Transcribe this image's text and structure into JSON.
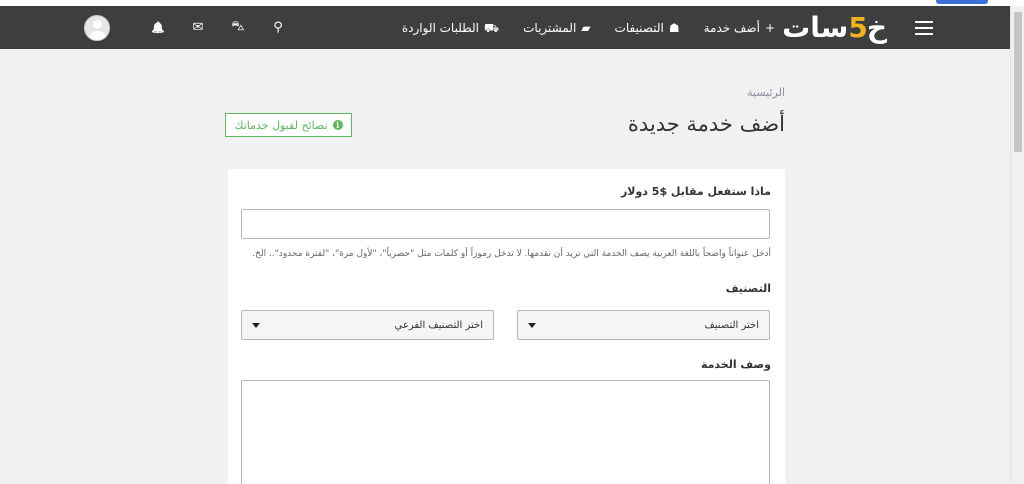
{
  "nav": {
    "logo_main_right": "خ",
    "logo_digit": "5",
    "logo_main_left": "سات",
    "links": [
      {
        "label": "أضف خدمة",
        "icon": "+"
      },
      {
        "label": "التصنيفات",
        "icon": "☗"
      },
      {
        "label": "المشتريات",
        "icon": "▰"
      },
      {
        "label": "الطلبات الواردة",
        "icon": "⛟"
      }
    ],
    "icons": {
      "search": "⚲",
      "cart": "⛍",
      "mail": "✉",
      "bell": "🔔"
    }
  },
  "page": {
    "breadcrumb": "الرئيسية",
    "title": "أضف خدمة جديدة",
    "tips_button": "نصائح لقبول خدماتك",
    "tips_icon": "i"
  },
  "form": {
    "title_label": "ماذا ستفعل مقابل $5 دولار",
    "title_value": "",
    "title_hint": "أدخل عنواناً واضحاً باللغة العربية يصف الخدمة التي تريد أن تقدمها. لا تدخل رموزاً أو كلمات مثل \"حصرياً\"، \"لأول مرة\"، \"لفترة محدود\".. الخ.",
    "category_label": "التصنيف",
    "category_select": "اختر التصنيف",
    "subcategory_select": "اختر التصنيف الفرعي",
    "description_label": "وصف الخدمة",
    "description_value": ""
  },
  "colors": {
    "navbar": "#3d3e3f",
    "logo_accent": "#f0b31a",
    "success": "#5cb85c",
    "background": "#f1f1f1"
  }
}
